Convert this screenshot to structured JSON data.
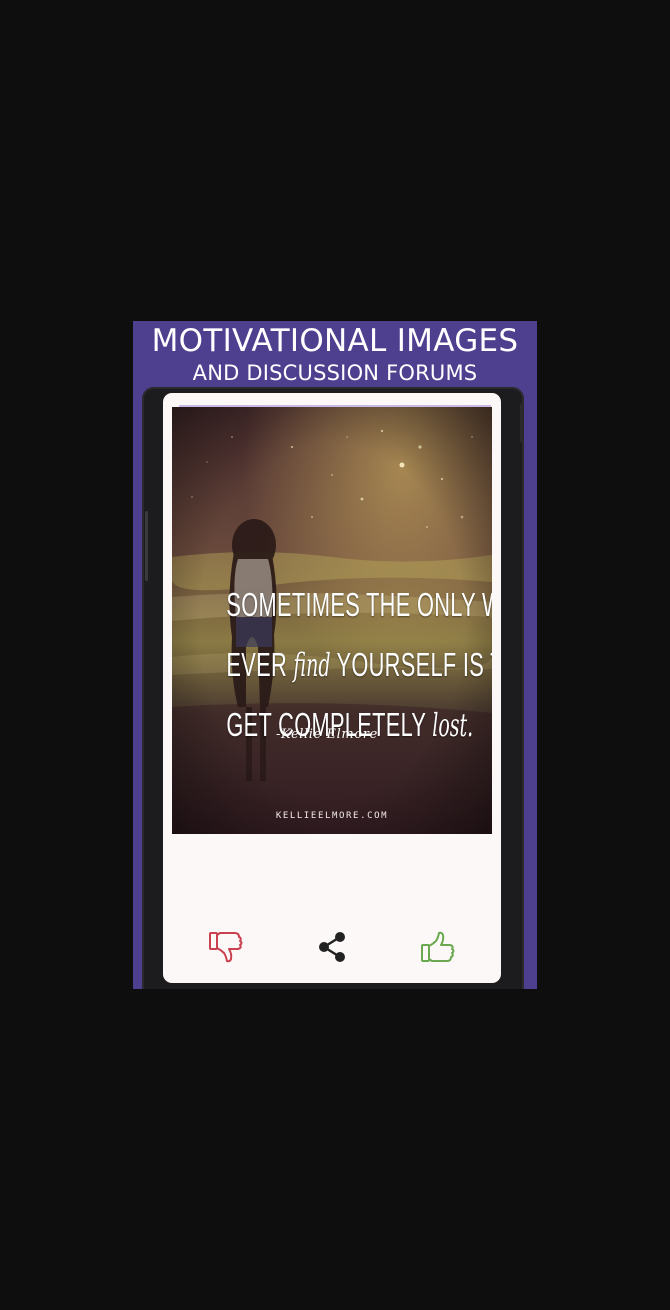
{
  "promo": {
    "title": "MOTIVATIONAL IMAGES",
    "subtitle": "AND DISCUSSION FORUMS"
  },
  "quote_image": {
    "lines": {
      "line1": "SOMETIMES THE ONLY WAY TO",
      "line2_a": "EVER ",
      "line2_b": "find",
      "line2_c": " YOURSELF IS TO",
      "line3_a": "GET COMPLETELY ",
      "line3_b": "lost."
    },
    "attribution": "-Kellie Elmore",
    "site_credit": "KELLIEELMORE.COM"
  },
  "actions": {
    "dislike_icon": "thumbs-down-icon",
    "share_icon": "share-icon",
    "like_icon": "thumbs-up-icon"
  },
  "colors": {
    "page_background": "#0e0e0e",
    "promo_background": "#4f3f8f",
    "card_background": "#fdf8f8",
    "dislike": "#c9404f",
    "like": "#6aa84f",
    "share": "#222222"
  }
}
